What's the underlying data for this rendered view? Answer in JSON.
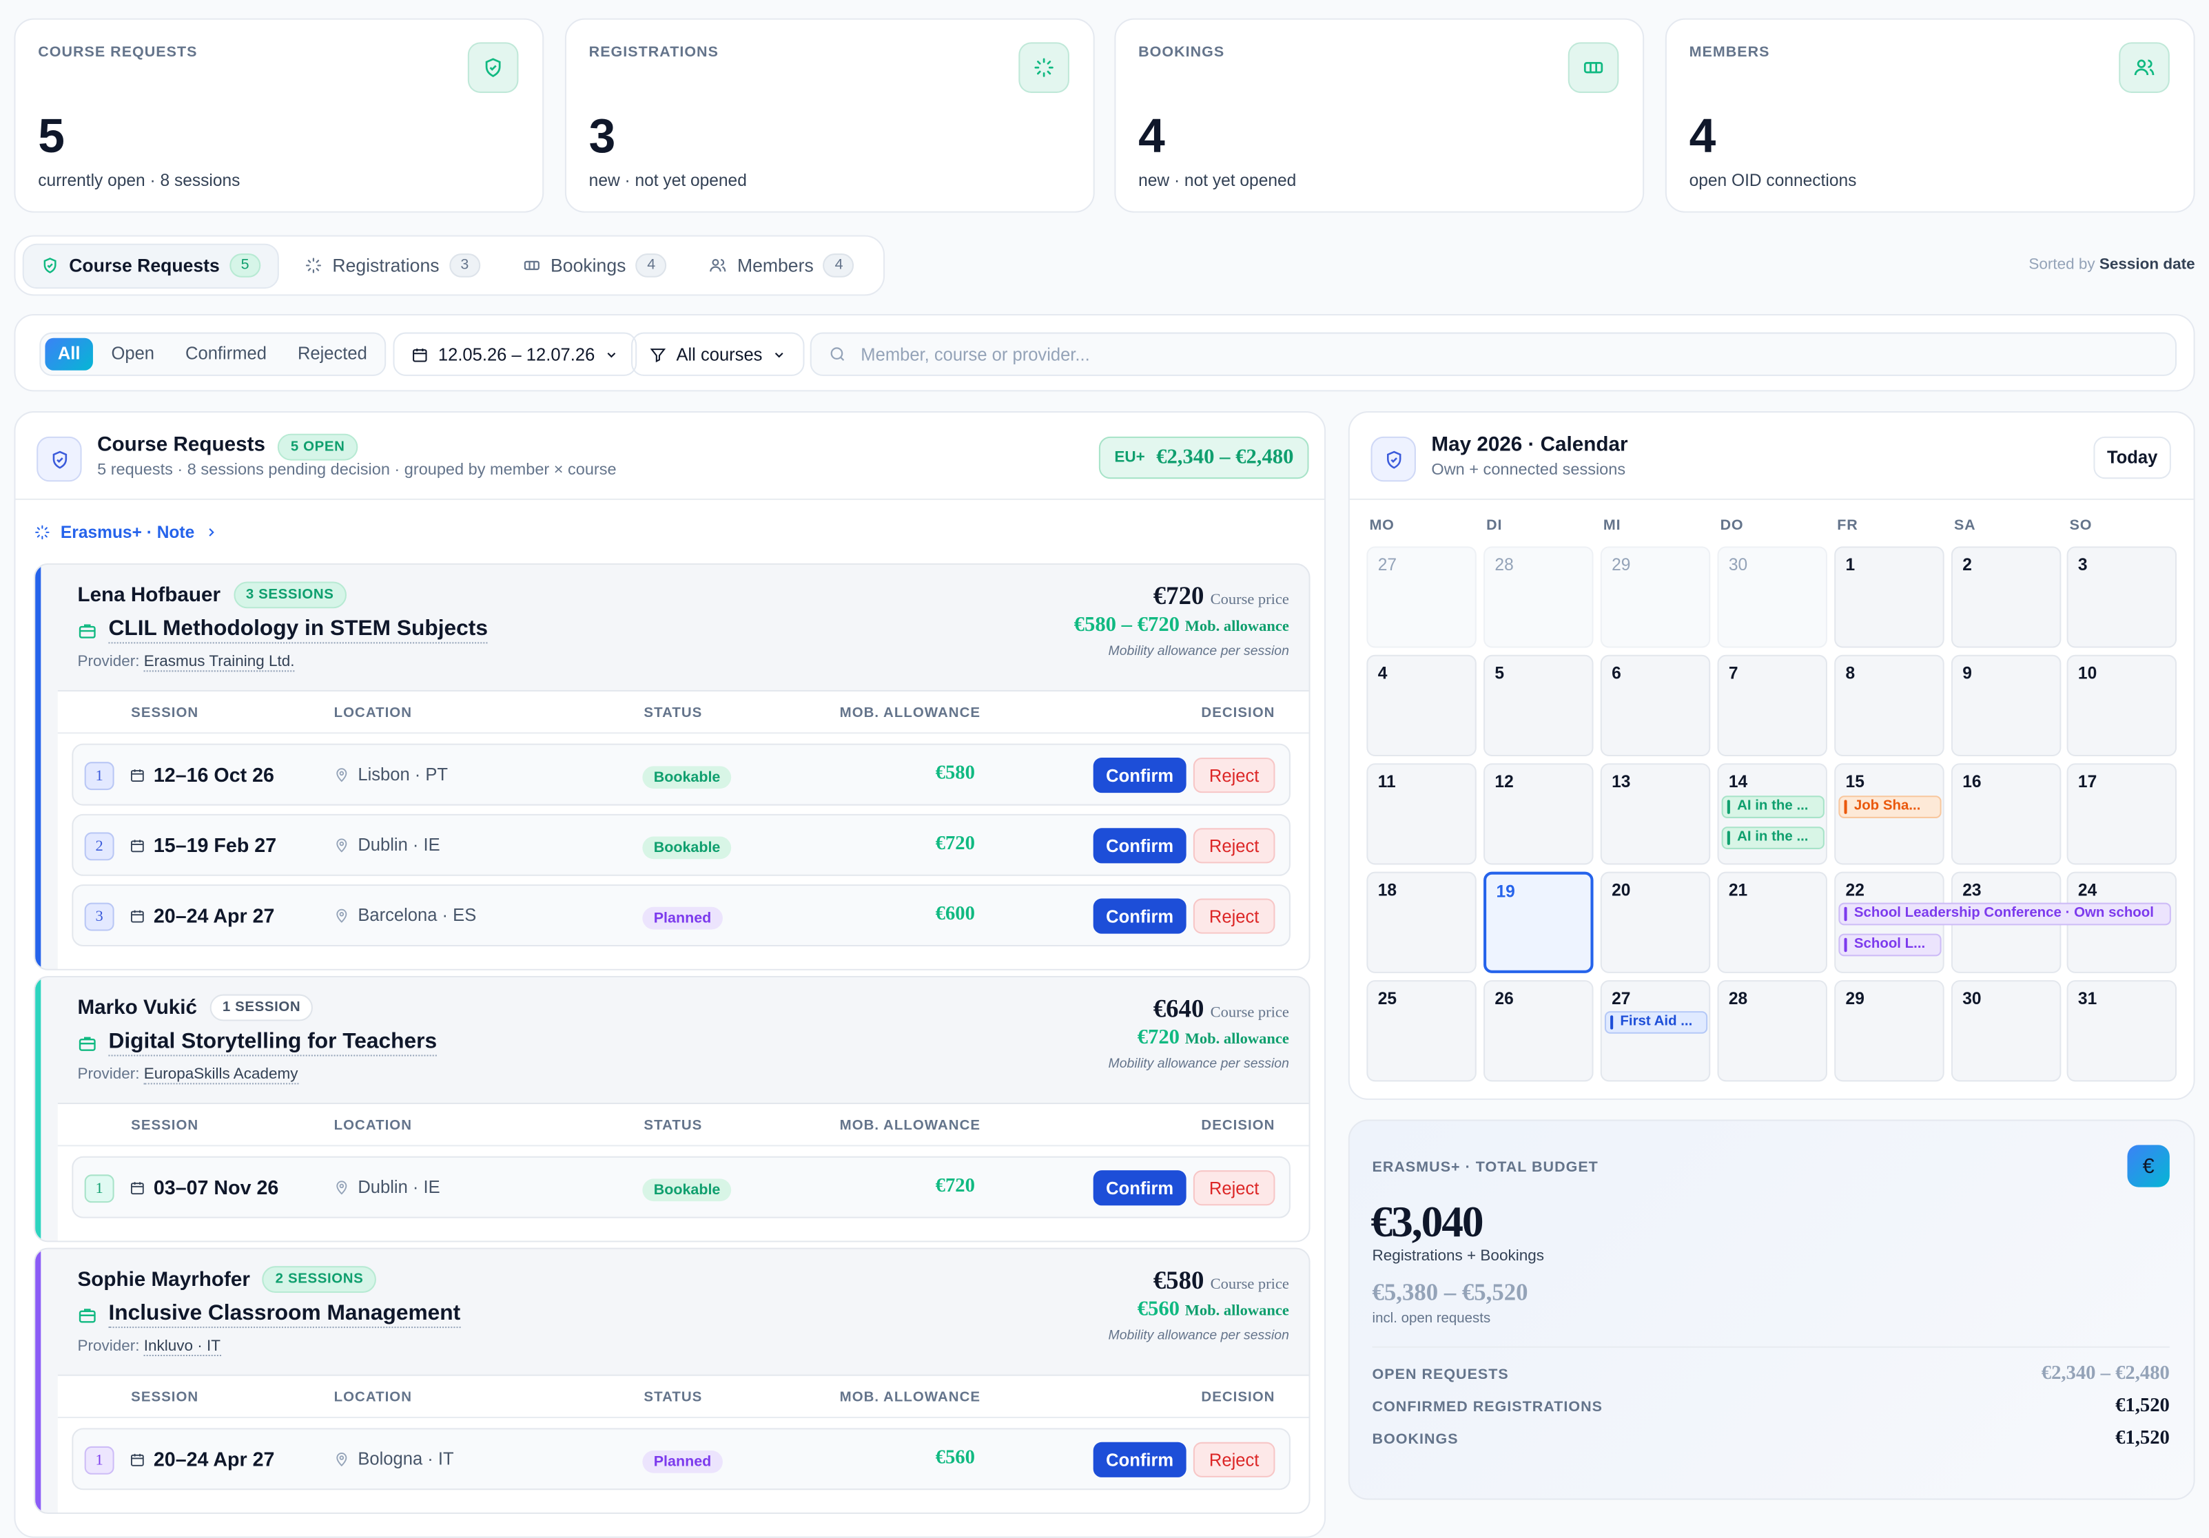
{
  "stats": [
    {
      "label": "COURSE REQUESTS",
      "value": "5",
      "sub": "currently open · 8 sessions",
      "icon": "shield-check-icon"
    },
    {
      "label": "REGISTRATIONS",
      "value": "3",
      "sub": "new · not yet opened",
      "icon": "loader-icon"
    },
    {
      "label": "BOOKINGS",
      "value": "4",
      "sub": "new · not yet opened",
      "icon": "ticket-icon"
    },
    {
      "label": "MEMBERS",
      "value": "4",
      "sub": "open OID connections",
      "icon": "users-icon"
    }
  ],
  "tabs": [
    {
      "label": "Course Requests",
      "count": "5",
      "icon": "shield-check-icon"
    },
    {
      "label": "Registrations",
      "count": "3",
      "icon": "loader-icon"
    },
    {
      "label": "Bookings",
      "count": "4",
      "icon": "ticket-icon"
    },
    {
      "label": "Members",
      "count": "4",
      "icon": "users-icon"
    }
  ],
  "sorted": {
    "prefix": "Sorted by",
    "value": "Session date"
  },
  "filters": {
    "segments": [
      "All",
      "Open",
      "Confirmed",
      "Rejected"
    ],
    "date_range": "12.05.26 – 12.07.26",
    "course_select": "All courses",
    "search_placeholder": "Member, course or provider..."
  },
  "requests": {
    "title": "Course Requests",
    "badge": "5 OPEN",
    "subtitle": "5 requests · 8 sessions pending decision · grouped by member × course",
    "eu_label": "EU+",
    "eu_amount": "€2,340 – €2,480",
    "note": "Erasmus+ · Note",
    "columns": {
      "session": "SESSION",
      "location": "LOCATION",
      "status": "STATUS",
      "allowance": "MOB. ALLOWANCE",
      "decision": "DECISION"
    },
    "confirm_label": "Confirm",
    "reject_label": "Reject",
    "provider_label": "Provider:",
    "price_label": "Course price",
    "allowance_label": "Mob. allowance",
    "allowance_info": "Mobility allowance per session",
    "groups": [
      {
        "member": "Lena Hofbauer",
        "sessions_badge": "3 SESSIONS",
        "course": "CLIL Methodology in STEM Subjects",
        "provider": "Erasmus Training Ltd.",
        "price": "€720",
        "allowance": "€580 – €720",
        "color": "#2563eb",
        "rows": [
          {
            "n": "1",
            "date": "12–16 Oct 26",
            "loc": "Lisbon · PT",
            "status": "Bookable",
            "amt": "€580"
          },
          {
            "n": "2",
            "date": "15–19 Feb 27",
            "loc": "Dublin · IE",
            "status": "Bookable",
            "amt": "€720"
          },
          {
            "n": "3",
            "date": "20–24 Apr 27",
            "loc": "Barcelona · ES",
            "status": "Planned",
            "amt": "€600"
          }
        ]
      },
      {
        "member": "Marko Vukić",
        "sessions_badge": "1 SESSION",
        "course": "Digital Storytelling for Teachers",
        "provider": "EuropaSkills Academy",
        "price": "€640",
        "allowance": "€720",
        "color": "#2dd4bf",
        "rows": [
          {
            "n": "1",
            "date": "03–07 Nov 26",
            "loc": "Dublin · IE",
            "status": "Bookable",
            "amt": "€720"
          }
        ]
      },
      {
        "member": "Sophie Mayrhofer",
        "sessions_badge": "2 SESSIONS",
        "course": "Inclusive Classroom Management",
        "provider": "Inkluvo · IT",
        "price": "€580",
        "allowance": "€560",
        "color": "#8b5cf6",
        "rows": [
          {
            "n": "1",
            "date": "20–24 Apr 27",
            "loc": "Bologna · IT",
            "status": "Planned",
            "amt": "€560"
          }
        ]
      }
    ]
  },
  "calendar": {
    "title": "May 2026 · Calendar",
    "subtitle": "Own + connected sessions",
    "today_label": "Today",
    "weekdays": [
      "MO",
      "DI",
      "MI",
      "DO",
      "FR",
      "SA",
      "SO"
    ],
    "weeks": [
      [
        "27",
        "28",
        "29",
        "30",
        "1",
        "2",
        "3"
      ],
      [
        "4",
        "5",
        "6",
        "7",
        "8",
        "9",
        "10"
      ],
      [
        "11",
        "12",
        "13",
        "14",
        "15",
        "16",
        "17"
      ],
      [
        "18",
        "19",
        "20",
        "21",
        "22",
        "23",
        "24"
      ],
      [
        "25",
        "26",
        "27",
        "28",
        "29",
        "30",
        "31"
      ]
    ],
    "events": {
      "ai1": "AI in the ...",
      "ai2": "AI in the ...",
      "job": "Job Sha...",
      "leadership": "School Leadership Conference · Own school",
      "schooll": "School L...",
      "firstaid": "First Aid ..."
    }
  },
  "budget": {
    "label": "ERASMUS+ · TOTAL BUDGET",
    "icon": "€",
    "total": "€3,040",
    "total_sub": "Registrations + Bookings",
    "range": "€5,380 – €5,520",
    "range_sub": "incl. open requests",
    "rows": [
      {
        "label": "OPEN REQUESTS",
        "value": "€2,340 – €2,480"
      },
      {
        "label": "CONFIRMED REGISTRATIONS",
        "value": "€1,520"
      },
      {
        "label": "BOOKINGS",
        "value": "€1,520"
      }
    ]
  }
}
